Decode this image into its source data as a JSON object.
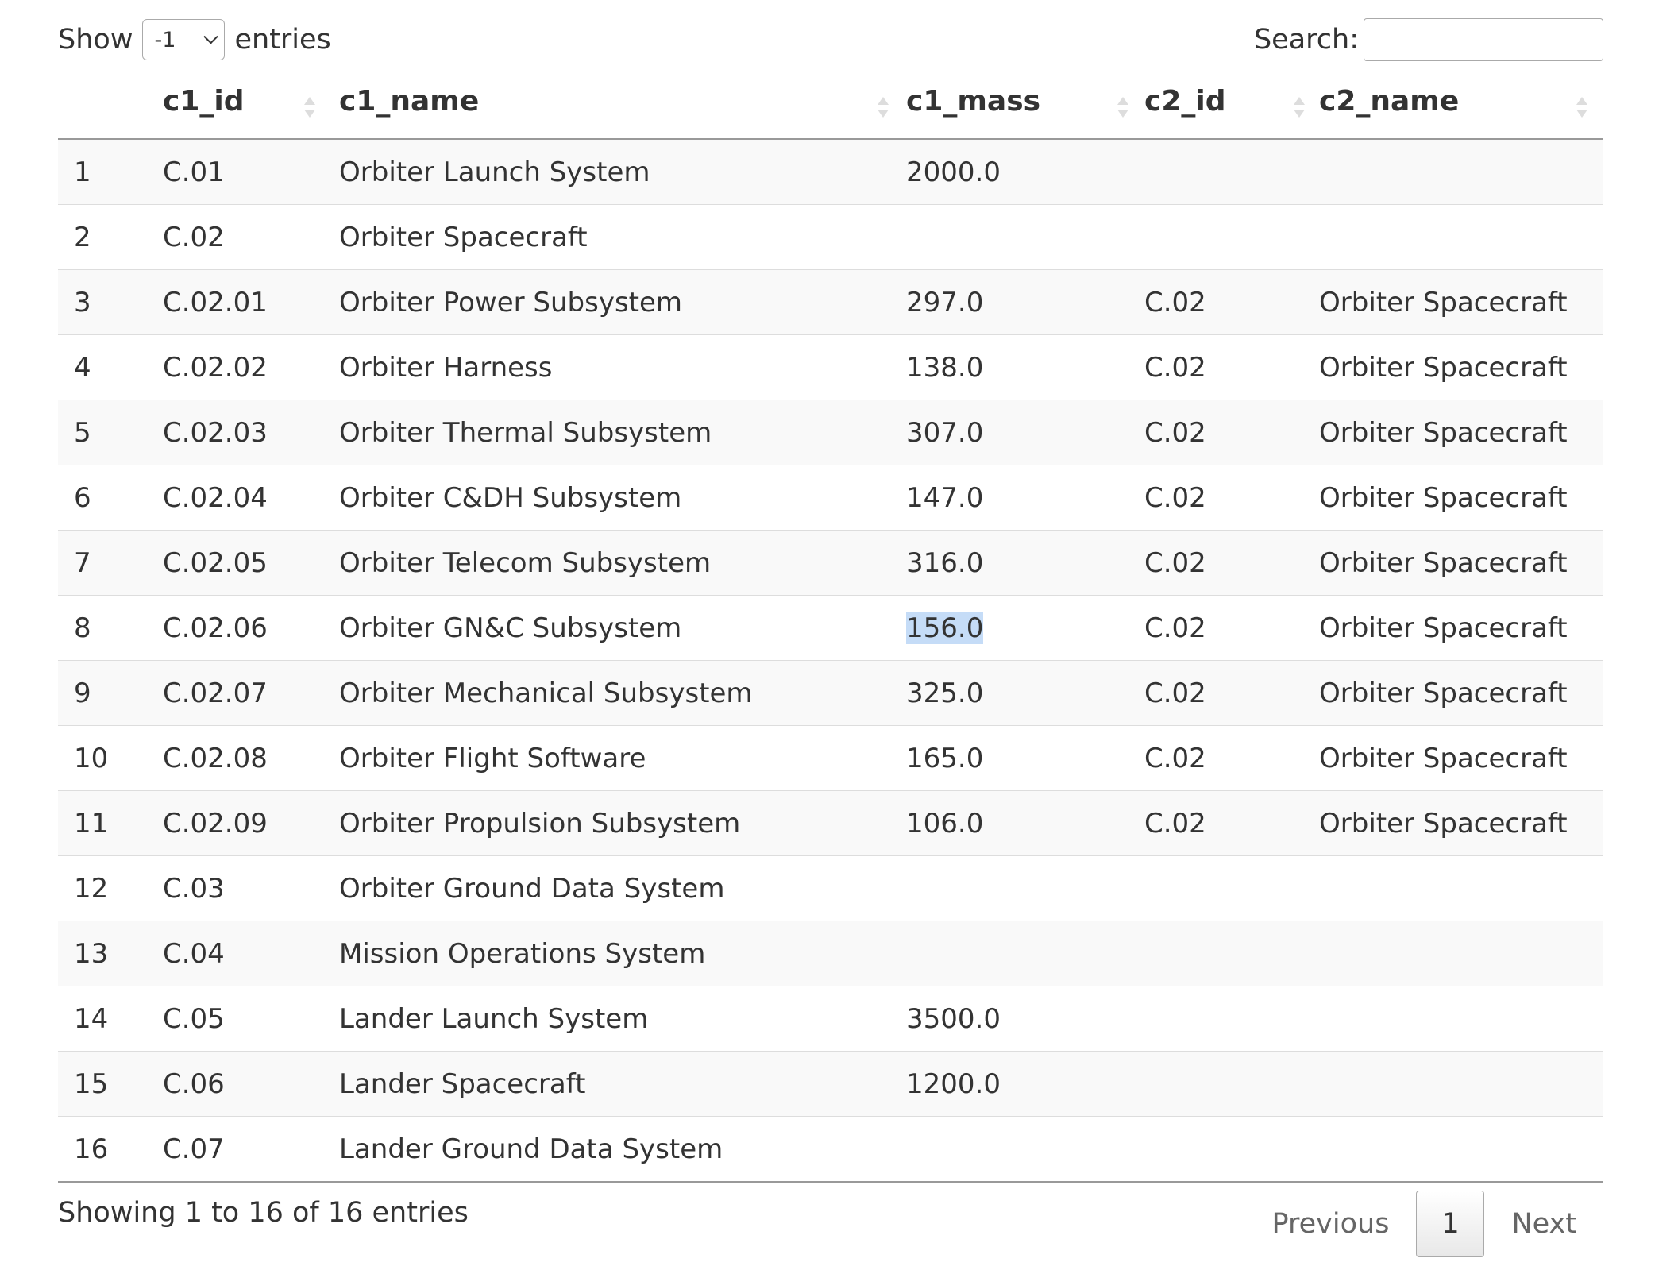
{
  "length_control": {
    "prefix": "Show",
    "value": "-1",
    "suffix": "entries"
  },
  "search": {
    "label": "Search:",
    "value": ""
  },
  "columns": [
    "",
    "c1_id",
    "c1_name",
    "c1_mass",
    "c2_id",
    "c2_name"
  ],
  "rows": [
    [
      "1",
      "C.01",
      "Orbiter Launch System",
      "2000.0",
      "",
      ""
    ],
    [
      "2",
      "C.02",
      "Orbiter Spacecraft",
      "",
      "",
      ""
    ],
    [
      "3",
      "C.02.01",
      "Orbiter Power Subsystem",
      "297.0",
      "C.02",
      "Orbiter Spacecraft"
    ],
    [
      "4",
      "C.02.02",
      "Orbiter Harness",
      "138.0",
      "C.02",
      "Orbiter Spacecraft"
    ],
    [
      "5",
      "C.02.03",
      "Orbiter Thermal Subsystem",
      "307.0",
      "C.02",
      "Orbiter Spacecraft"
    ],
    [
      "6",
      "C.02.04",
      "Orbiter C&DH Subsystem",
      "147.0",
      "C.02",
      "Orbiter Spacecraft"
    ],
    [
      "7",
      "C.02.05",
      "Orbiter Telecom Subsystem",
      "316.0",
      "C.02",
      "Orbiter Spacecraft"
    ],
    [
      "8",
      "C.02.06",
      "Orbiter GN&C Subsystem",
      "156.0",
      "C.02",
      "Orbiter Spacecraft"
    ],
    [
      "9",
      "C.02.07",
      "Orbiter Mechanical Subsystem",
      "325.0",
      "C.02",
      "Orbiter Spacecraft"
    ],
    [
      "10",
      "C.02.08",
      "Orbiter Flight Software",
      "165.0",
      "C.02",
      "Orbiter Spacecraft"
    ],
    [
      "11",
      "C.02.09",
      "Orbiter Propulsion Subsystem",
      "106.0",
      "C.02",
      "Orbiter Spacecraft"
    ],
    [
      "12",
      "C.03",
      "Orbiter Ground Data System",
      "",
      "",
      ""
    ],
    [
      "13",
      "C.04",
      "Mission Operations System",
      "",
      "",
      ""
    ],
    [
      "14",
      "C.05",
      "Lander Launch System",
      "3500.0",
      "",
      ""
    ],
    [
      "15",
      "C.06",
      "Lander Spacecraft",
      "1200.0",
      "",
      ""
    ],
    [
      "16",
      "C.07",
      "Lander Ground Data System",
      "",
      "",
      ""
    ]
  ],
  "selection": {
    "row": 7,
    "col": 3
  },
  "info_text": "Showing 1 to 16 of 16 entries",
  "pagination": {
    "previous": "Previous",
    "current": "1",
    "next": "Next"
  },
  "colors": {
    "selection_highlight": "#c5dcf7",
    "stripe": "#f9f9f9",
    "text": "#333333"
  },
  "icons": {
    "sort": "sort-both-icon",
    "select": "chevron-down-icon"
  }
}
